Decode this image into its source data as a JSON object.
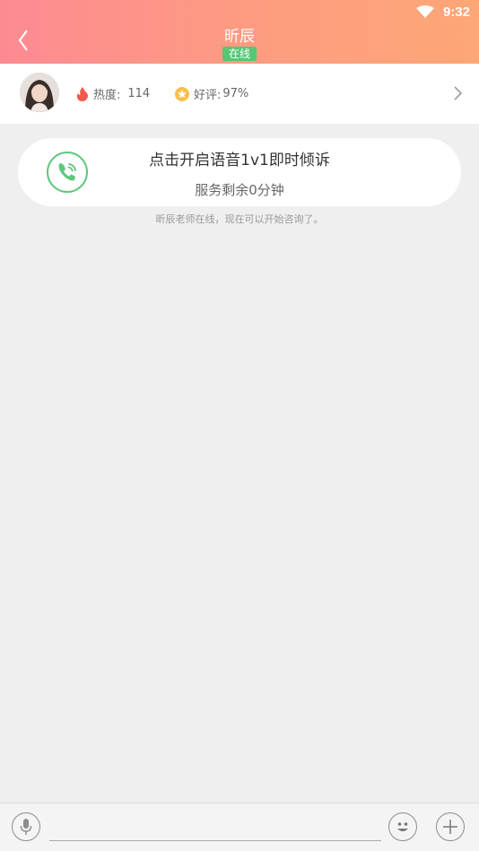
{
  "status_bar": {
    "time": "9:32"
  },
  "header": {
    "title": "昕辰",
    "badge": "在线",
    "gradient_start": "#fd8a92",
    "gradient_end": "#fda676"
  },
  "profile": {
    "heat_label": "热度:",
    "heat_value": "114",
    "rating_label": "好评:",
    "rating_value": "97%"
  },
  "call_card": {
    "title": "点击开启语音1v1即时倾诉",
    "remaining": "服务剩余0分钟",
    "accent": "#5fc77e"
  },
  "system_note": "昕辰老师在线，现在可以开始咨询了。",
  "input_bar": {
    "placeholder": "",
    "icons": [
      "mic-icon",
      "emoji-icon",
      "plus-icon"
    ]
  }
}
